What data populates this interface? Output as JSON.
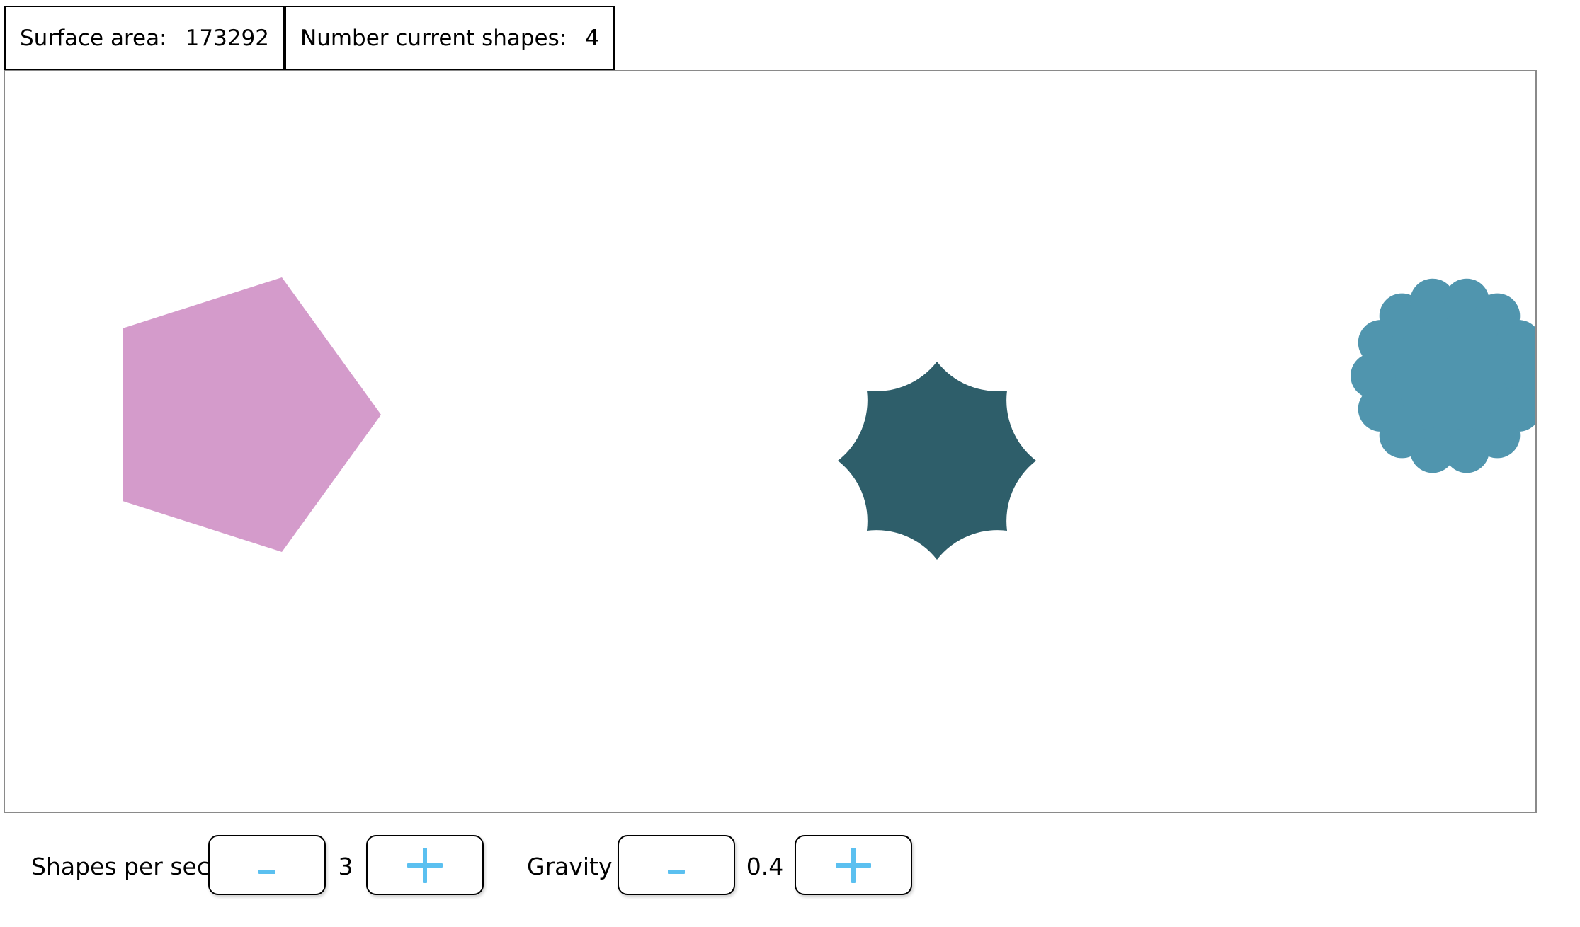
{
  "stats": {
    "surface_label": "Surface area:",
    "surface_value": "173292",
    "shapes_label": "Number current shapes:",
    "shapes_value": "4"
  },
  "controls": {
    "shapes_per_sec": {
      "label": "Shapes per sec",
      "minus_label": "-",
      "value": "3",
      "plus_label": "+"
    },
    "gravity": {
      "label": "Gravity",
      "minus_label": "-",
      "value": "0.4",
      "plus_label": "+"
    }
  },
  "colors": {
    "button_glyph": "#5bc0f0",
    "stage_border": "#8a8a8a",
    "pentagon": "#d49bcb",
    "star": "#2e5e6a",
    "cloud": "#5095ae"
  },
  "shapes": [
    {
      "kind": "pentagon",
      "color": "#d49bcb"
    },
    {
      "kind": "star-8-concave",
      "color": "#2e5e6a"
    },
    {
      "kind": "cloud-scalloped",
      "color": "#5095ae"
    }
  ]
}
